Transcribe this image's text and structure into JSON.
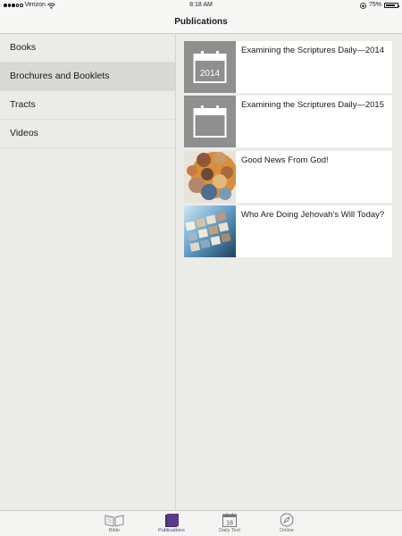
{
  "status_bar": {
    "carrier": "Verizon",
    "time": "8:18 AM",
    "battery_percent": "75%",
    "battery_level": 0.75
  },
  "nav": {
    "title": "Publications"
  },
  "sidebar": {
    "items": [
      {
        "label": "Books",
        "selected": false
      },
      {
        "label": "Brochures and Booklets",
        "selected": true
      },
      {
        "label": "Tracts",
        "selected": false
      },
      {
        "label": "Videos",
        "selected": false
      }
    ]
  },
  "publications": [
    {
      "title": "Examining the Scriptures Daily—2014",
      "thumb": "calendar",
      "thumb_label": "2014"
    },
    {
      "title": "Examining the Scriptures Daily—2015",
      "thumb": "calendar",
      "thumb_label": ""
    },
    {
      "title": "Good News From God!",
      "thumb": "photo-collage"
    },
    {
      "title": "Who Are Doing Jehovah’s Will Today?",
      "thumb": "photo-tiles"
    }
  ],
  "tab_bar": {
    "tabs": [
      {
        "label": "Bible",
        "icon": "open-book-icon",
        "active": false
      },
      {
        "label": "Publications",
        "icon": "publications-icon",
        "active": true
      },
      {
        "label": "Daily Text",
        "icon": "calendar-icon",
        "active": false,
        "badge": "18"
      },
      {
        "label": "Online",
        "icon": "compass-icon",
        "active": false
      }
    ]
  },
  "colors": {
    "accent": "#5b3a8e",
    "thumb_gray": "#8f8f8f",
    "selected_row": "#d8d8d4"
  }
}
